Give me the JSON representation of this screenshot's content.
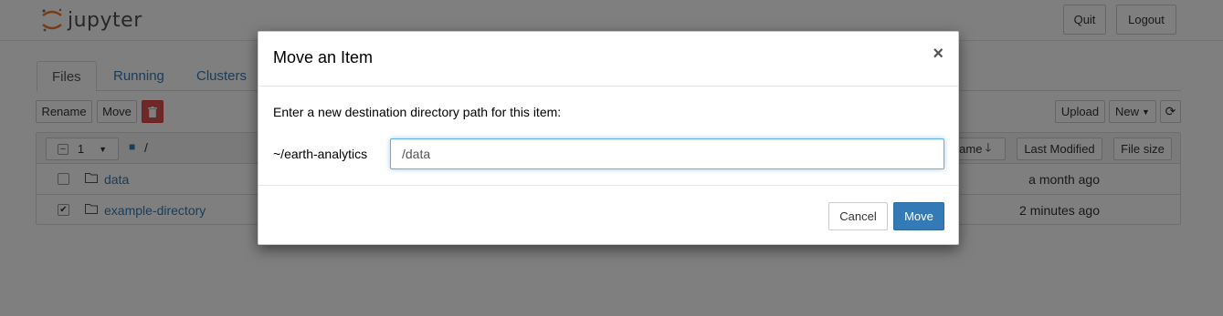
{
  "header": {
    "logo_text": "jupyter",
    "quit_label": "Quit",
    "logout_label": "Logout"
  },
  "tabs": [
    {
      "label": "Files"
    },
    {
      "label": "Running"
    },
    {
      "label": "Clusters"
    }
  ],
  "toolbar": {
    "rename_label": "Rename",
    "move_label": "Move",
    "upload_label": "Upload",
    "new_label": "New"
  },
  "list_header": {
    "selected_count": "1",
    "path": "/",
    "name_sort_label": "Name",
    "last_modified_label": "Last Modified",
    "file_size_label": "File size"
  },
  "files": [
    {
      "name": "data",
      "modified": "a month ago",
      "checked": false
    },
    {
      "name": "example-directory",
      "modified": "2 minutes ago",
      "checked": true
    }
  ],
  "modal": {
    "title": "Move an Item",
    "close_glyph": "×",
    "prompt": "Enter a new destination directory path for this item:",
    "path_prefix": "~/earth-analytics",
    "input_value": "/data",
    "cancel_label": "Cancel",
    "move_label": "Move"
  },
  "colors": {
    "link": "#337ab7",
    "primary": "#337ab7",
    "danger": "#d9534f",
    "logo_orange": "#f37726"
  }
}
